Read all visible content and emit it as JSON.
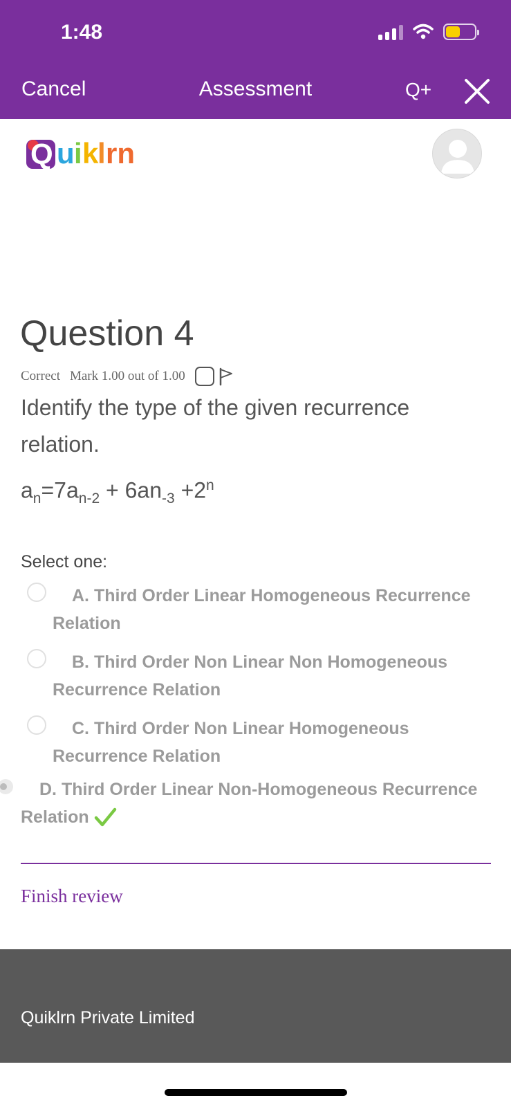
{
  "status_bar": {
    "time": "1:48",
    "icons": [
      "cellular-signal-icon",
      "wifi-icon",
      "battery-icon"
    ],
    "battery_color": "#f9d000"
  },
  "nav": {
    "cancel": "Cancel",
    "title": "Assessment",
    "qplus": "Q+",
    "close_icon": "close-icon",
    "background": "#7a2f9d"
  },
  "header": {
    "logo_text": "Quiklrn",
    "avatar_icon": "user-avatar-icon"
  },
  "question": {
    "title": "Question 4",
    "status": "Correct",
    "mark": "Mark 1.00 out of 1.00",
    "flag_icon": "flag-icon",
    "text": "Identify the type of the given recurrence relation.",
    "formula": {
      "a1": "a",
      "s1": "n",
      "eq": "=7a",
      "s2": "n-2",
      "mid": " + 6an",
      "s3": "-3",
      "plus": " +2",
      "sup": "n"
    },
    "select_prompt": "Select one:",
    "options": [
      {
        "letter": "A.",
        "line1": "Third Order Linear Homogeneous Recurrence",
        "line2": "Relation",
        "selected": false
      },
      {
        "letter": "B.",
        "line1": "Third Order Non Linear Non Homogeneous",
        "line2": "Recurrence Relation",
        "selected": false
      },
      {
        "letter": "C.",
        "line1": "Third Order Non Linear Homogeneous",
        "line2": "Recurrence Relation",
        "selected": false
      },
      {
        "letter": "D.",
        "line1": "Third Order Linear Non-Homogeneous Recurrence",
        "line2": "Relation",
        "selected": true,
        "correct_icon": "checkmark-icon"
      }
    ]
  },
  "actions": {
    "finish_review": "Finish review"
  },
  "footer": {
    "company": "Quiklrn Private Limited"
  },
  "colors": {
    "accent": "#7a2f9d",
    "correct": "#7ac943",
    "footer_bg": "#595959"
  }
}
